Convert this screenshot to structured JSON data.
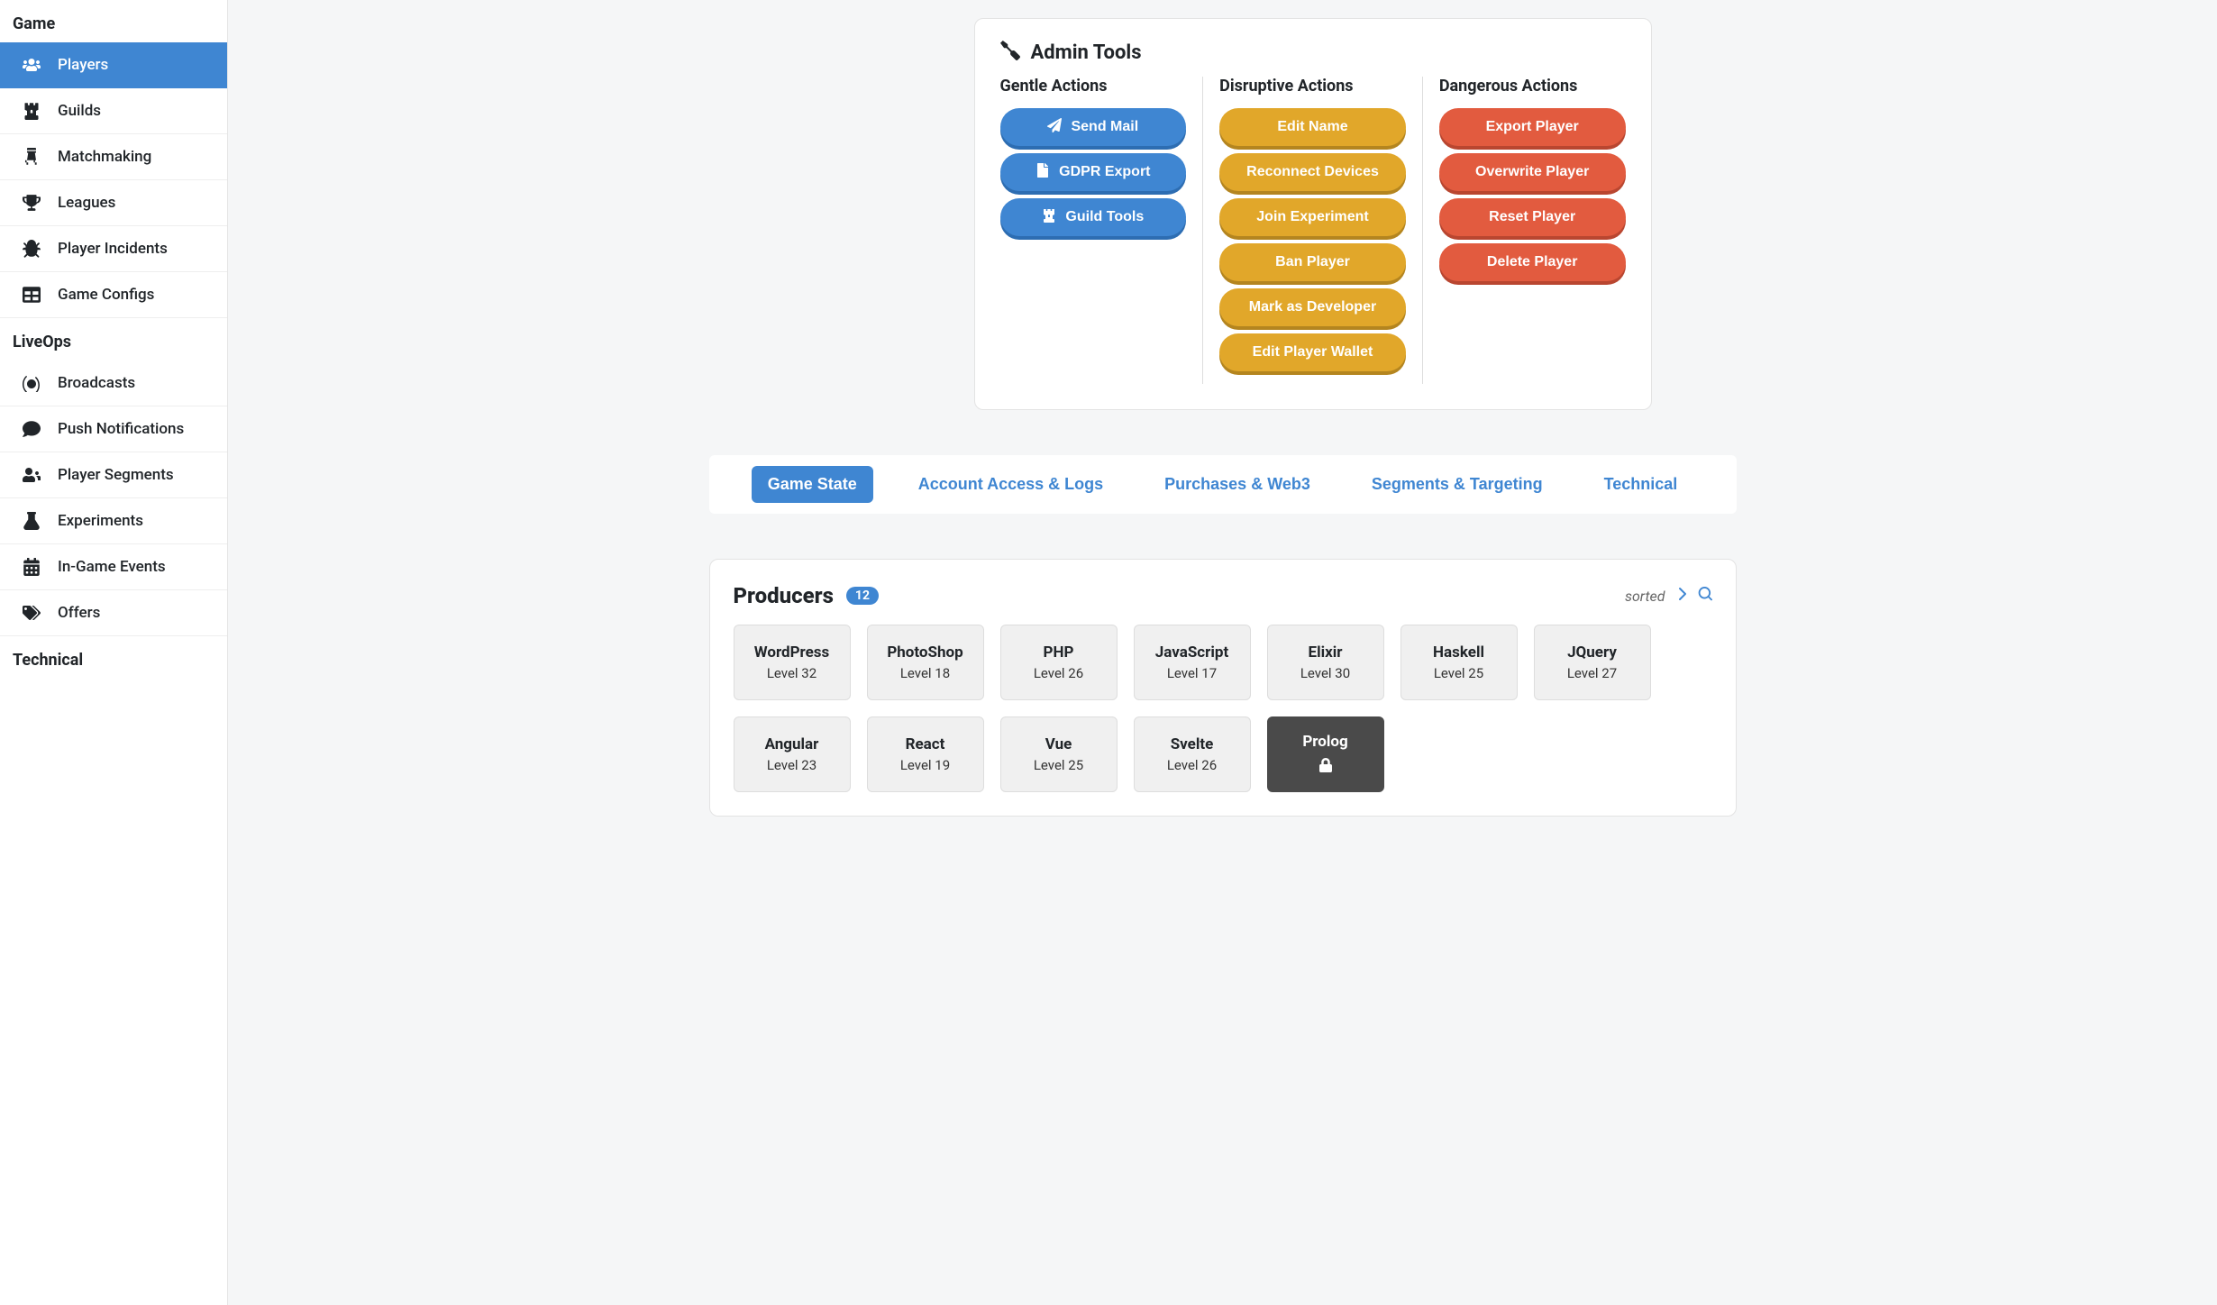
{
  "sidebar": {
    "sections": [
      {
        "title": "Game",
        "items": [
          {
            "icon": "users",
            "label": "Players",
            "active": true
          },
          {
            "icon": "chess-rook",
            "label": "Guilds"
          },
          {
            "icon": "chess",
            "label": "Matchmaking"
          },
          {
            "icon": "trophy",
            "label": "Leagues"
          },
          {
            "icon": "bug",
            "label": "Player Incidents"
          },
          {
            "icon": "table",
            "label": "Game Configs"
          }
        ]
      },
      {
        "title": "LiveOps",
        "items": [
          {
            "icon": "broadcast",
            "label": "Broadcasts"
          },
          {
            "icon": "comment",
            "label": "Push Notifications"
          },
          {
            "icon": "user-segment",
            "label": "Player Segments"
          },
          {
            "icon": "flask",
            "label": "Experiments"
          },
          {
            "icon": "calendar",
            "label": "In-Game Events"
          },
          {
            "icon": "tags",
            "label": "Offers"
          }
        ]
      },
      {
        "title": "Technical",
        "items": []
      }
    ]
  },
  "admin_tools": {
    "title": "Admin Tools",
    "columns": [
      {
        "title": "Gentle Actions",
        "color": "blue",
        "buttons": [
          {
            "icon": "paper-plane",
            "label": "Send Mail"
          },
          {
            "icon": "file",
            "label": "GDPR Export"
          },
          {
            "icon": "chess-rook",
            "label": "Guild Tools"
          }
        ]
      },
      {
        "title": "Disruptive Actions",
        "color": "yellow",
        "buttons": [
          {
            "label": "Edit Name"
          },
          {
            "label": "Reconnect Devices"
          },
          {
            "label": "Join Experiment"
          },
          {
            "label": "Ban Player"
          },
          {
            "label": "Mark as Developer"
          },
          {
            "label": "Edit Player Wallet"
          }
        ]
      },
      {
        "title": "Dangerous Actions",
        "color": "red",
        "buttons": [
          {
            "label": "Export Player"
          },
          {
            "label": "Overwrite Player"
          },
          {
            "label": "Reset Player"
          },
          {
            "label": "Delete Player"
          }
        ]
      }
    ]
  },
  "tabs": [
    {
      "label": "Game State",
      "active": true
    },
    {
      "label": "Account Access & Logs"
    },
    {
      "label": "Purchases & Web3"
    },
    {
      "label": "Segments & Targeting"
    },
    {
      "label": "Technical"
    }
  ],
  "producers": {
    "title": "Producers",
    "count": "12",
    "sorted_label": "sorted",
    "items": [
      {
        "name": "WordPress",
        "level": "Level 32"
      },
      {
        "name": "PhotoShop",
        "level": "Level 18"
      },
      {
        "name": "PHP",
        "level": "Level 26"
      },
      {
        "name": "JavaScript",
        "level": "Level 17"
      },
      {
        "name": "Elixir",
        "level": "Level 30"
      },
      {
        "name": "Haskell",
        "level": "Level 25"
      },
      {
        "name": "JQuery",
        "level": "Level 27"
      },
      {
        "name": "Angular",
        "level": "Level 23"
      },
      {
        "name": "React",
        "level": "Level 19"
      },
      {
        "name": "Vue",
        "level": "Level 25"
      },
      {
        "name": "Svelte",
        "level": "Level 26"
      },
      {
        "name": "Prolog",
        "locked": true
      }
    ]
  }
}
